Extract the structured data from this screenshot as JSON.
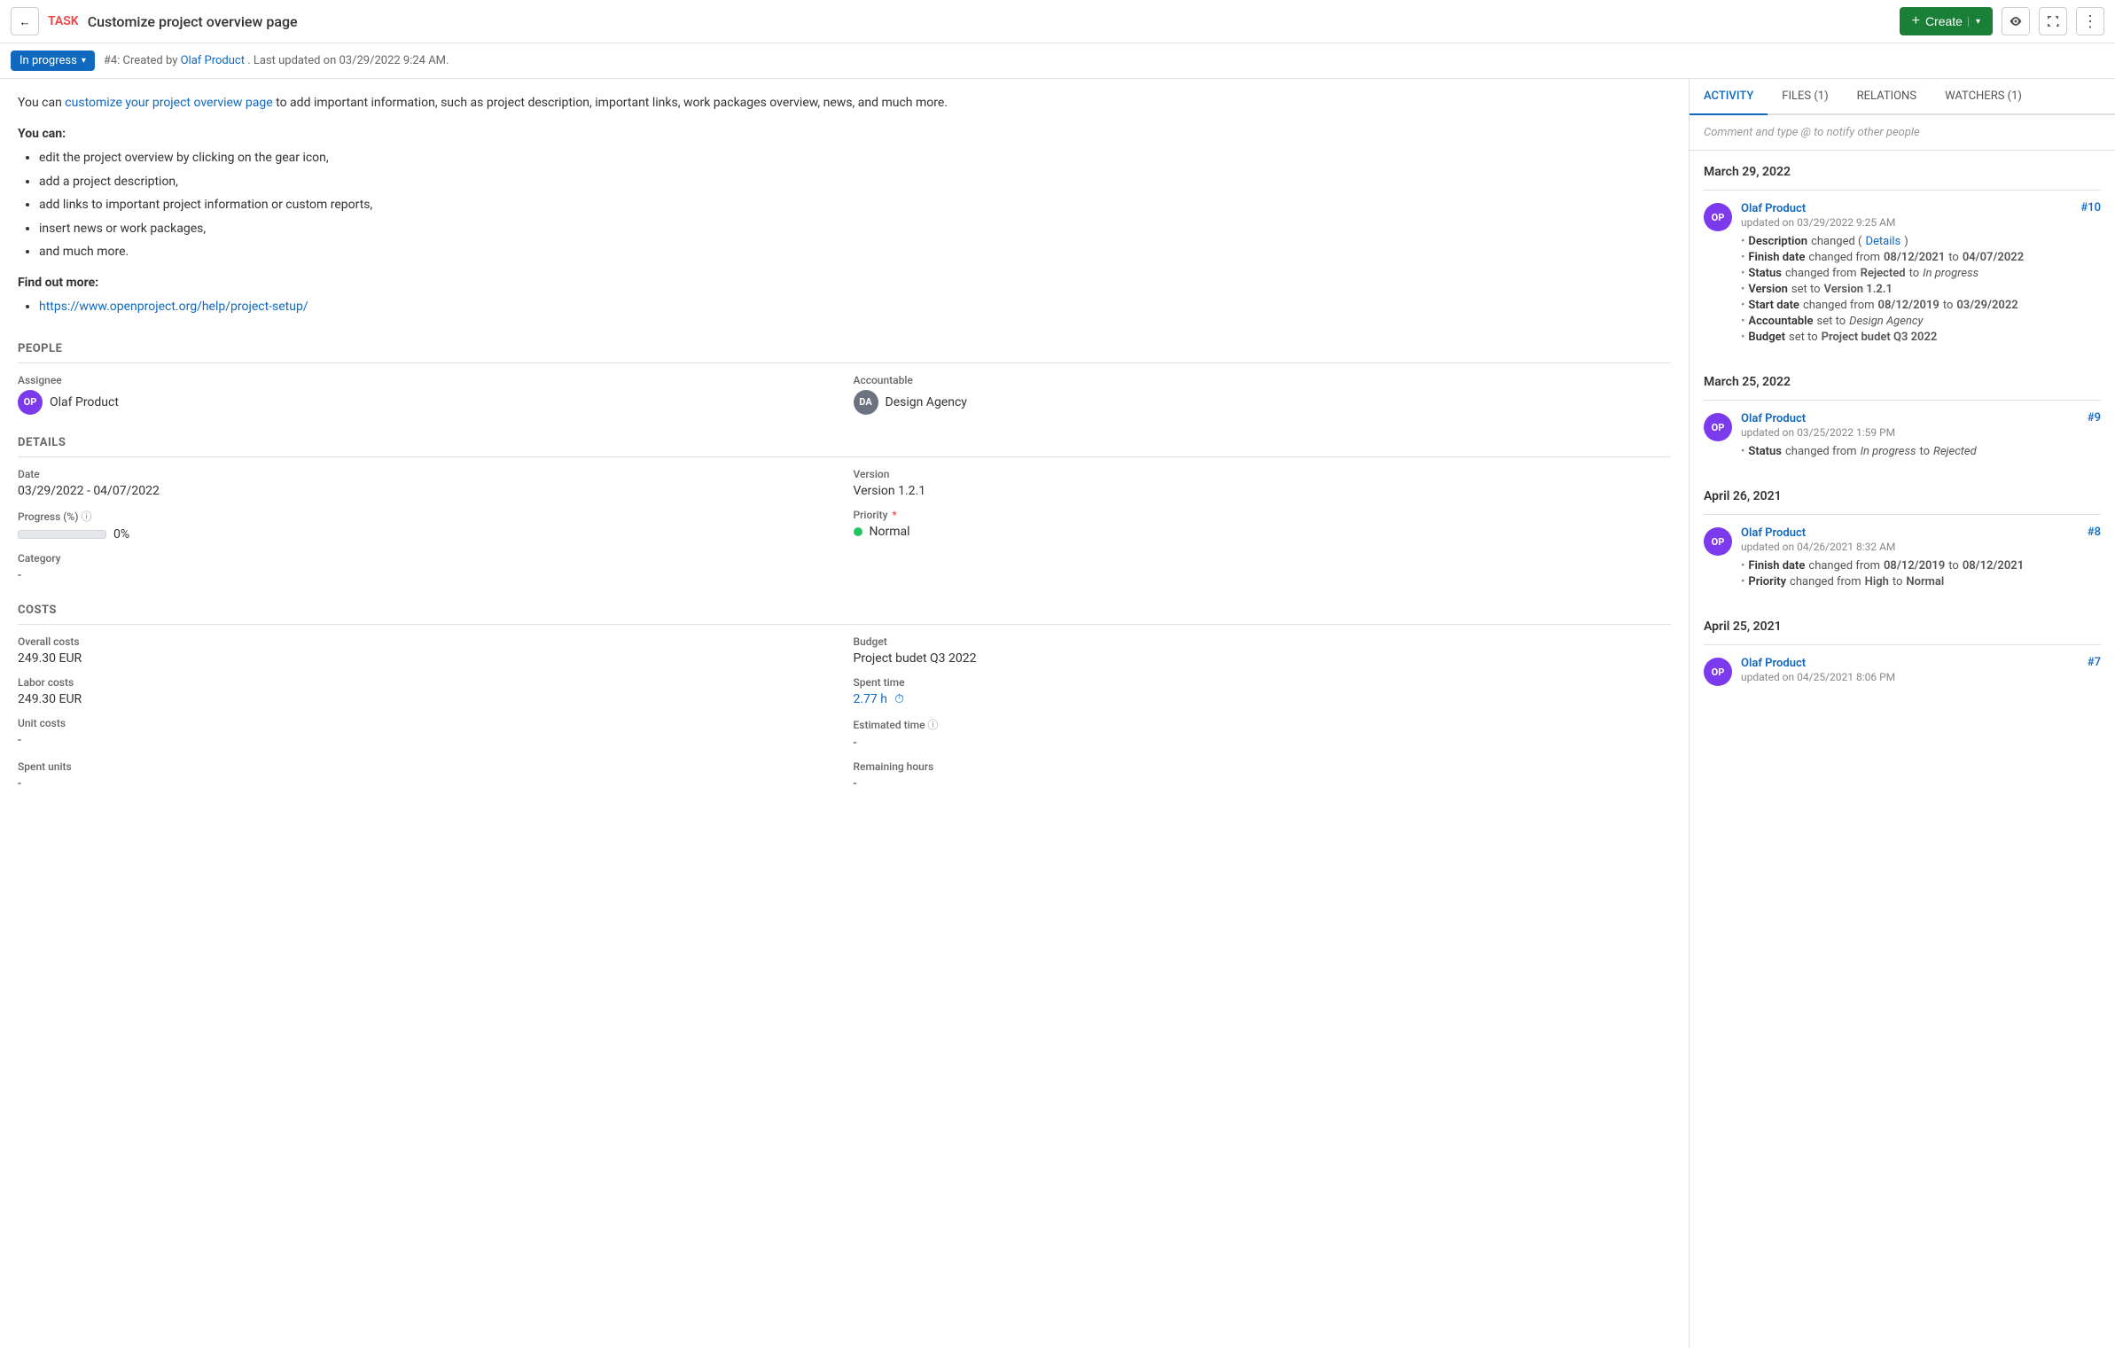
{
  "header": {
    "back_label": "←",
    "task_label": "TASK",
    "title": "Customize project overview page",
    "create_label": "Create",
    "create_plus": "+",
    "create_chevron": "▾"
  },
  "subheader": {
    "status": "In progress",
    "meta": "#4: Created by",
    "author": "Olaf Product",
    "last_updated": ". Last updated on 03/29/2022 9:24 AM."
  },
  "description": {
    "intro_pre": "You can ",
    "intro_link_text": "customize your project overview page",
    "intro_post": " to add important information, such as project description, important links, work packages overview, news, and much more.",
    "you_can_label": "You can:",
    "bullets": [
      "edit the project overview by clicking on the gear icon,",
      "add a project description,",
      "add links to important project information or custom reports,",
      "insert news or work packages,",
      "and much more."
    ],
    "find_out_label": "Find out more:",
    "url": "https://www.openproject.org/help/project-setup/"
  },
  "people": {
    "section_title": "PEOPLE",
    "assignee_label": "Assignee",
    "assignee_name": "Olaf Product",
    "assignee_initials": "OP",
    "accountable_label": "Accountable",
    "accountable_name": "Design Agency",
    "accountable_initials": "DA"
  },
  "details": {
    "section_title": "DETAILS",
    "date_label": "Date",
    "date_value": "03/29/2022 - 04/07/2022",
    "version_label": "Version",
    "version_value": "Version 1.2.1",
    "progress_label": "Progress (%)",
    "progress_value": "0%",
    "priority_label": "Priority",
    "priority_value": "Normal",
    "category_label": "Category",
    "category_value": "-"
  },
  "costs": {
    "section_title": "COSTS",
    "overall_label": "Overall costs",
    "overall_value": "249.30 EUR",
    "budget_label": "Budget",
    "budget_value": "Project budet Q3 2022",
    "labor_label": "Labor costs",
    "labor_value": "249.30 EUR",
    "spent_time_label": "Spent time",
    "spent_time_value": "2.77 h",
    "unit_label": "Unit costs",
    "unit_value": "-",
    "estimated_label": "Estimated time",
    "estimated_value": "-",
    "spent_units_label": "Spent units",
    "spent_units_value": "-",
    "remaining_label": "Remaining hours",
    "remaining_value": "-"
  },
  "right_panel": {
    "tabs": [
      {
        "id": "activity",
        "label": "ACTIVITY",
        "active": true
      },
      {
        "id": "files",
        "label": "FILES (1)",
        "active": false
      },
      {
        "id": "relations",
        "label": "RELATIONS",
        "active": false
      },
      {
        "id": "watchers",
        "label": "WATCHERS (1)",
        "active": false
      }
    ],
    "comment_placeholder": "Comment and type @ to notify other people",
    "dates": [
      {
        "date": "March 29, 2022",
        "items": [
          {
            "user": "Olaf Product",
            "initials": "OP",
            "updated": "updated on 03/29/2022 9:25 AM",
            "num": "#10",
            "changes": [
              {
                "field": "Description",
                "text": " changed (",
                "link": "Details",
                "post": ")"
              },
              {
                "field": "Finish date",
                "text": " changed from ",
                "from": "08/12/2021",
                "to": "04/07/2022"
              },
              {
                "field": "Status",
                "text": " changed from ",
                "from_plain": "Rejected",
                "to_italic": "In progress"
              },
              {
                "field": "Version",
                "text": " set to ",
                "value": "Version 1.2.1"
              },
              {
                "field": "Start date",
                "text": " changed from ",
                "from": "08/12/2019",
                "to": "03/29/2022"
              },
              {
                "field": "Accountable",
                "text": " set to ",
                "value_italic": "Design Agency"
              },
              {
                "field": "Budget",
                "text": " set to ",
                "value": "Project budet Q3 2022"
              }
            ]
          }
        ]
      },
      {
        "date": "March 25, 2022",
        "items": [
          {
            "user": "Olaf Product",
            "initials": "OP",
            "updated": "updated on 03/25/2022 1:59 PM",
            "num": "#9",
            "changes": [
              {
                "field": "Status",
                "text": " changed from ",
                "from_italic": "In progress",
                "to_italic": "Rejected"
              }
            ]
          }
        ]
      },
      {
        "date": "April 26, 2021",
        "items": [
          {
            "user": "Olaf Product",
            "initials": "OP",
            "updated": "updated on 04/26/2021 8:32 AM",
            "num": "#8",
            "changes": [
              {
                "field": "Finish date",
                "text": " changed from ",
                "from": "08/12/2019",
                "to": "08/12/2021"
              },
              {
                "field": "Priority",
                "text": " changed from ",
                "from_plain": "High",
                "to_plain": "Normal"
              }
            ]
          }
        ]
      },
      {
        "date": "April 25, 2021",
        "items": [
          {
            "user": "Olaf Product",
            "initials": "OP",
            "updated": "updated on 04/25/2021 8:06 PM",
            "num": "#7",
            "changes": []
          }
        ]
      }
    ]
  }
}
